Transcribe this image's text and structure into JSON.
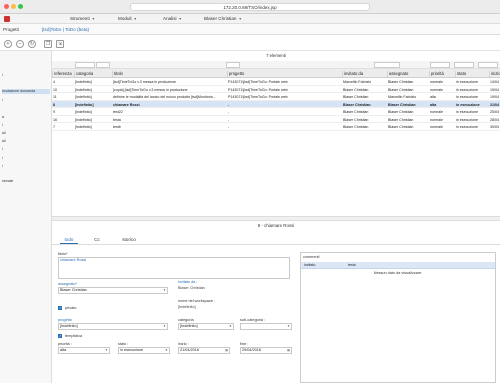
{
  "browser": {
    "url": "172.20.0.69/TSO/index.jsp"
  },
  "menubar": {
    "items": [
      {
        "label": "Strumenti"
      },
      {
        "label": "Moduli"
      },
      {
        "label": "Analisi"
      },
      {
        "label": "Blaser Christian"
      }
    ]
  },
  "tabs": {
    "projects": "Progetti",
    "active": "[tsd]ToDo | ToDo (beta)"
  },
  "sidebar": {
    "items": [
      {
        "label": "i"
      },
      {
        "label": "ircolazione domanda"
      },
      {
        "label": "i"
      },
      {
        "label": "a"
      },
      {
        "label": "i"
      },
      {
        "label": "ail"
      },
      {
        "label": "ail"
      },
      {
        "label": "i"
      },
      {
        "label": "i"
      },
      {
        "label": "i"
      },
      {
        "label": "sionale"
      }
    ]
  },
  "grid": {
    "count": "7 elementi",
    "columns": [
      "referenza",
      "categoria",
      "titolo",
      "progetto",
      "invitato da",
      "assegnato",
      "priorità",
      "stato",
      "inizio"
    ],
    "rows": [
      [
        "4",
        "[Indefinito]",
        "[tsd]TimeToGo v.3 messa in produzione",
        "P143071\\[tsd]TimeToGo: Portale web",
        "Marcellin Fabrizio",
        "Blaser Christian",
        "normale",
        "in esecuzione",
        "14/04"
      ],
      [
        "10",
        "[Indefinito]",
        "[copia] [tsd]TimeToGo v.3 messa in produzione",
        "P143071\\[tsd]TimeToGo: Portale web",
        "Blaser Christian",
        "Blaser Christian",
        "normale",
        "in esecuzione",
        "15/04"
      ],
      [
        "11",
        "[Indefinito]",
        "definire le modalità del lancio del nuovo prodotto [tsd]Monitorin...",
        "P143071\\[tsd]TimeToGo: Portale web",
        "Blaser Christian",
        "Marcellin Fabrizio",
        "alta",
        "in esecuzione",
        "19/04"
      ],
      [
        "8",
        "[Indefinito]",
        "chiamare Rossi",
        "-",
        "Blaser Christian",
        "Blaser Christian",
        "alta",
        "in esecuzione",
        "21/04"
      ],
      [
        "9",
        "[Indefinito]",
        "test22",
        "-",
        "Blaser Christian",
        "Blaser Christian",
        "normale",
        "in esecuzione",
        "25/04"
      ],
      [
        "16",
        "[Indefinito]",
        "testa",
        "-",
        "Blaser Christian",
        "Blaser Christian",
        "normale",
        "in esecuzione",
        "28/04"
      ],
      [
        "7",
        "[Indefinito]",
        "testb",
        "-",
        "Blaser Christian",
        "Blaser Christian",
        "normale",
        "in esecuzione",
        "30/04"
      ]
    ]
  },
  "detail": {
    "title": "8 - chiamare Rossi",
    "tabs": [
      "todo",
      "Cc",
      "storico"
    ],
    "form": {
      "titolo_label": "titolo*",
      "titolo_value": "chiamare Rossi",
      "assegnato_label": "assegnato*",
      "assegnato_value": "Blaser Christian",
      "invitato_label": "invitato da :",
      "invitato_value": "Blaser Christian",
      "privato_label": "privato",
      "workspace_label": "nome del workspace :",
      "workspace_value": "[Indefinito]",
      "progetto_label": "progetto",
      "progetto_value": "[Indefinito]",
      "categoria_label": "categoria",
      "categoria_value": "[Indefinito]",
      "subcat_label": "sub-categoria :",
      "subcat_value": "",
      "tempistica_label": "tempistica",
      "priorita_label": "priorità :",
      "priorita_value": "alta",
      "stato_label": "stato :",
      "stato_value": "in esecuzione",
      "inizio_label": "inizio :",
      "inizio_value": "21/04/2016",
      "fine_label": "fine :",
      "fine_value": "29/04/2016"
    },
    "comments": {
      "title": "commenti",
      "col_invitato": "invitato",
      "col_testo": "testo",
      "empty": "Nessun dato da visualizzare."
    }
  }
}
